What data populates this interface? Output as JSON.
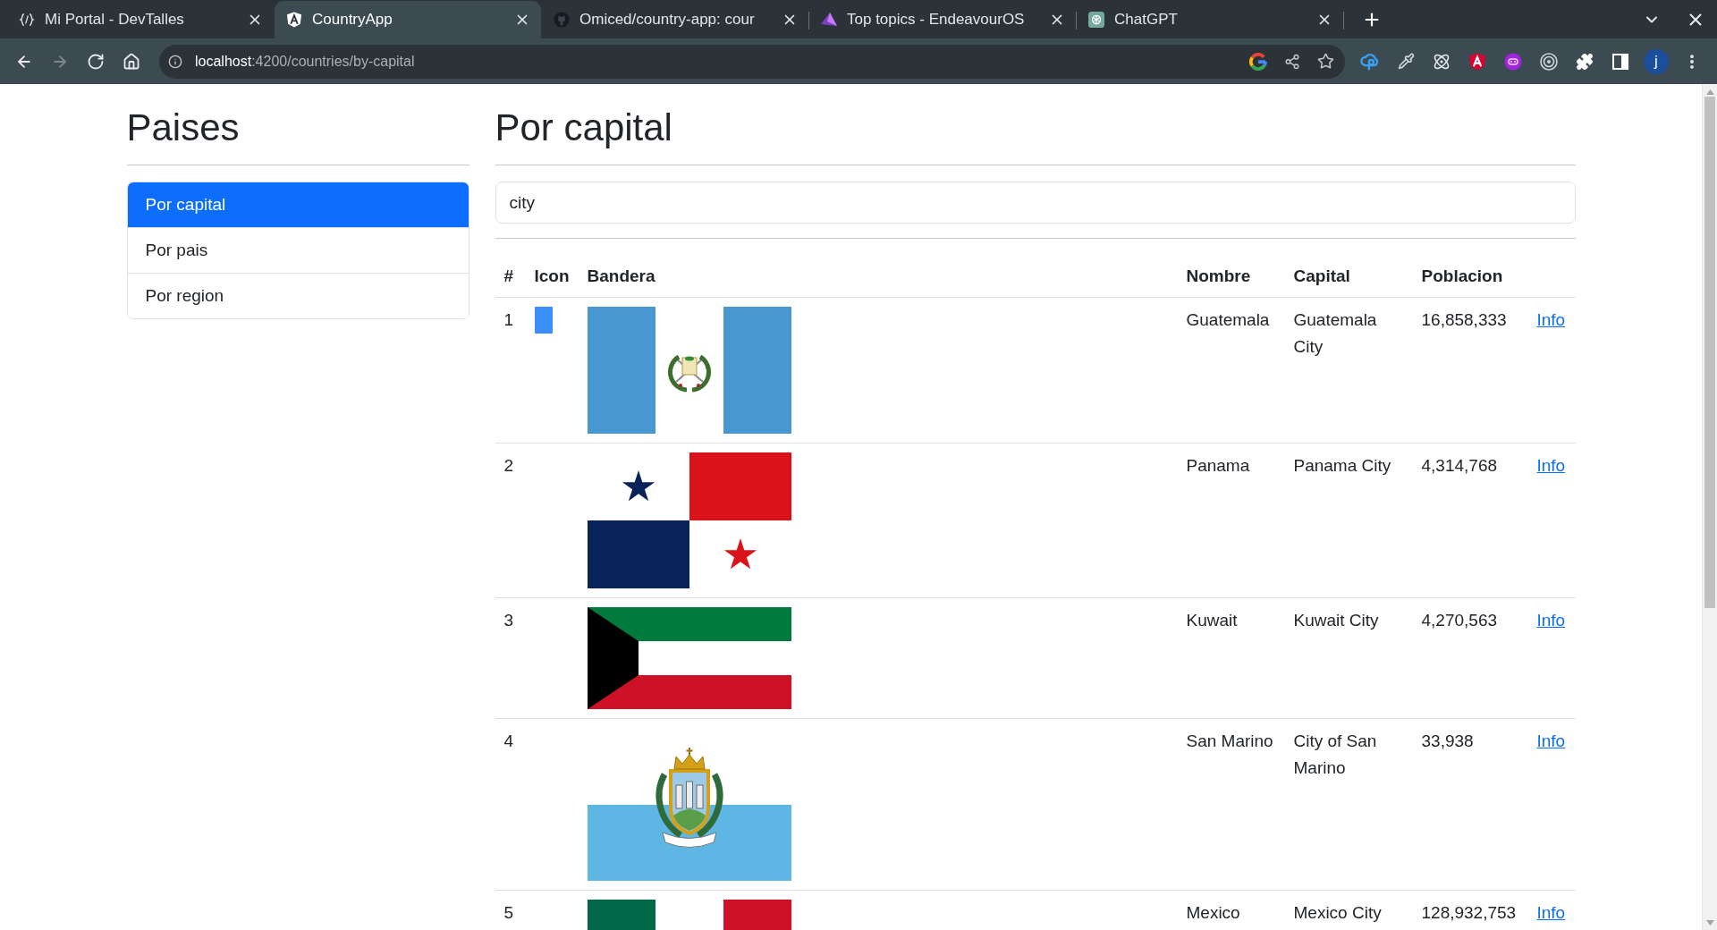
{
  "browser": {
    "tabs": [
      {
        "title": "Mi Portal - DevTalles",
        "selected": false
      },
      {
        "title": "CountryApp",
        "selected": true
      },
      {
        "title": "Omiced/country-app: cour",
        "selected": false
      },
      {
        "title": "Top topics - EndeavourOS",
        "selected": false
      },
      {
        "title": "ChatGPT",
        "selected": false
      }
    ],
    "nav_buttons": [
      {
        "kind": "back",
        "disabled": false
      },
      {
        "kind": "forward",
        "disabled": true
      },
      {
        "kind": "reload",
        "disabled": false
      },
      {
        "kind": "home",
        "disabled": false
      }
    ],
    "address": {
      "host": "localhost",
      "path": ":4200/countries/by-capital"
    },
    "profile": {
      "initial": "j"
    }
  },
  "sidebar": {
    "title": "Paises",
    "items": [
      {
        "label": "Por capital",
        "selected": true
      },
      {
        "label": "Por pais",
        "selected": false
      },
      {
        "label": "Por region",
        "selected": false
      }
    ]
  },
  "main": {
    "title": "Por capital",
    "search": {
      "value": "city"
    },
    "table": {
      "columns": [
        "#",
        "Icon",
        "Bandera",
        "Nombre",
        "Capital",
        "Poblacion"
      ],
      "rows": [
        {
          "number": "1",
          "icon": true,
          "kind": "guatemala",
          "name": "Guatemala",
          "capital": "Guatemala City",
          "population": "16,858,333",
          "link": "Info"
        },
        {
          "number": "2",
          "icon": false,
          "kind": "panama",
          "name": "Panama",
          "capital": "Panama City",
          "population": "4,314,768",
          "link": "Info"
        },
        {
          "number": "3",
          "icon": false,
          "kind": "kuwait",
          "name": "Kuwait",
          "capital": "Kuwait City",
          "population": "4,270,563",
          "link": "Info"
        },
        {
          "number": "4",
          "icon": false,
          "kind": "san_marino",
          "name": "San Marino",
          "capital": "City of San Marino",
          "population": "33,938",
          "link": "Info"
        },
        {
          "number": "5",
          "icon": false,
          "kind": "mexico",
          "name": "Mexico",
          "capital": "Mexico City",
          "population": "128,932,753",
          "link": "Info"
        }
      ]
    }
  }
}
